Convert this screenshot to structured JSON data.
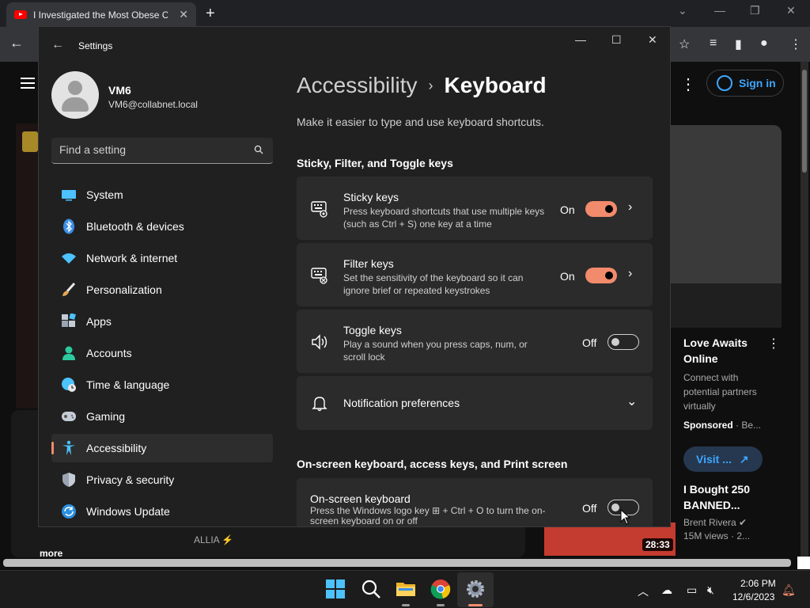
{
  "browser": {
    "tab_title": "I Investigated the Most Obese C",
    "new_tab": "+",
    "close_tab": "✕"
  },
  "youtube": {
    "sign_in": "Sign in",
    "ad_title": "Love Awaits Online",
    "ad_desc": "Connect with potential partners virtually",
    "ad_sponsored": "Sponsored",
    "ad_advertiser": " · Be...",
    "ad_visit": "Visit ...",
    "video_title": "I Bought 250 BANNED...",
    "video_channel": "Brent Rivera",
    "video_views": "15M views · 2...",
    "video_duration": "28:33",
    "below_text": "ALLIA",
    "more": "more"
  },
  "settings": {
    "window_title": "Settings",
    "user_name": "VM6",
    "user_email": "VM6@collabnet.local",
    "search_placeholder": "Find a setting",
    "nav": [
      {
        "label": "System",
        "icon": "monitor-icon"
      },
      {
        "label": "Bluetooth & devices",
        "icon": "bluetooth-icon"
      },
      {
        "label": "Network & internet",
        "icon": "wifi-icon"
      },
      {
        "label": "Personalization",
        "icon": "brush-icon"
      },
      {
        "label": "Apps",
        "icon": "apps-icon"
      },
      {
        "label": "Accounts",
        "icon": "person-icon"
      },
      {
        "label": "Time & language",
        "icon": "globe-clock-icon"
      },
      {
        "label": "Gaming",
        "icon": "controller-icon"
      },
      {
        "label": "Accessibility",
        "icon": "accessibility-icon",
        "active": true
      },
      {
        "label": "Privacy & security",
        "icon": "shield-icon"
      },
      {
        "label": "Windows Update",
        "icon": "update-icon"
      }
    ],
    "breadcrumb_parent": "Accessibility",
    "breadcrumb_sep": "›",
    "breadcrumb_current": "Keyboard",
    "subtitle": "Make it easier to type and use keyboard shortcuts.",
    "section1": "Sticky, Filter, and Toggle keys",
    "sticky": {
      "title": "Sticky keys",
      "desc": "Press keyboard shortcuts that use multiple keys (such as Ctrl + S) one key at a time",
      "state": "On"
    },
    "filter": {
      "title": "Filter keys",
      "desc": "Set the sensitivity of the keyboard so it can ignore brief or repeated keystrokes",
      "state": "On"
    },
    "toggle_keys": {
      "title": "Toggle keys",
      "desc": "Play a sound when you press caps, num, or scroll lock",
      "state": "Off"
    },
    "notification": {
      "title": "Notification preferences"
    },
    "section2": "On-screen keyboard, access keys, and Print screen",
    "osk": {
      "title": "On-screen keyboard",
      "desc": "Press the Windows logo key ⊞ + Ctrl + O to turn the on-screen keyboard on or off",
      "state": "Off"
    }
  },
  "taskbar": {
    "time": "2:06 PM",
    "date": "12/6/2023"
  },
  "colors": {
    "accent": "#f28a6c",
    "youtube_red": "#ff0000",
    "link_blue": "#3ea6ff"
  }
}
